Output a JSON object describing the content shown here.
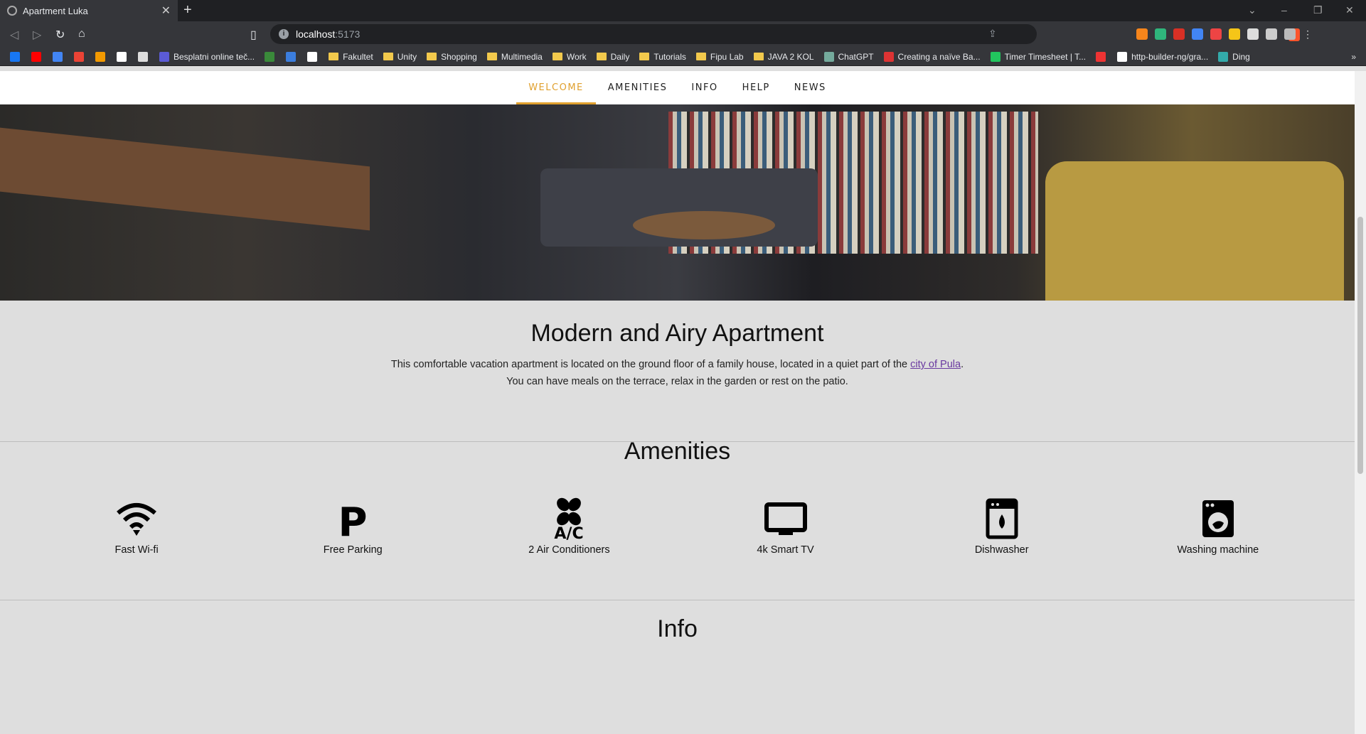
{
  "browser": {
    "tab_title": "Apartment Luka",
    "url_host": "localhost",
    "url_port": ":5173",
    "bookmarks": [
      {
        "label": "",
        "icon": "facebook-icon",
        "color": "#1877f2"
      },
      {
        "label": "",
        "icon": "youtube-icon",
        "color": "#ff0000"
      },
      {
        "label": "",
        "icon": "translate-icon",
        "color": "#4285f4"
      },
      {
        "label": "",
        "icon": "gmail-icon",
        "color": "#ea4335"
      },
      {
        "label": "",
        "icon": "in-icon",
        "color": "#f29900"
      },
      {
        "label": "",
        "icon": "github-icon",
        "color": "#ffffff"
      },
      {
        "label": "",
        "icon": "monitor-icon",
        "color": "#dddddd"
      },
      {
        "label": "Besplatni online teč...",
        "icon": "course-icon",
        "color": "#5b5bd6"
      },
      {
        "label": "",
        "icon": "leaf-icon",
        "color": "#3a8a3a"
      },
      {
        "label": "",
        "icon": "diamond-icon",
        "color": "#3b7ddd"
      },
      {
        "label": "",
        "icon": "notion-icon",
        "color": "#ffffff"
      },
      {
        "label": "Fakultet",
        "icon": "folder-icon"
      },
      {
        "label": "Unity",
        "icon": "folder-icon"
      },
      {
        "label": "Shopping",
        "icon": "folder-icon"
      },
      {
        "label": "Multimedia",
        "icon": "folder-icon"
      },
      {
        "label": "Work",
        "icon": "folder-icon"
      },
      {
        "label": "Daily",
        "icon": "folder-icon"
      },
      {
        "label": "Tutorials",
        "icon": "folder-icon"
      },
      {
        "label": "Fipu Lab",
        "icon": "folder-icon"
      },
      {
        "label": "JAVA 2 KOL",
        "icon": "folder-icon"
      },
      {
        "label": "ChatGPT",
        "icon": "chatgpt-icon",
        "color": "#74aa9c"
      },
      {
        "label": "Creating a naïve Ba...",
        "icon": "article-icon",
        "color": "#d33"
      },
      {
        "label": "Timer Timesheet | T...",
        "icon": "timer-icon",
        "color": "#22c55e"
      },
      {
        "label": "",
        "icon": "pin-icon",
        "color": "#e33"
      },
      {
        "label": "http-builder-ng/gra...",
        "icon": "github-icon",
        "color": "#ffffff"
      },
      {
        "label": "Ding",
        "icon": "ding-icon",
        "color": "#3aa"
      }
    ]
  },
  "nav": {
    "items": [
      "WELCOME",
      "AMENITIES",
      "INFO",
      "HELP",
      "NEWS"
    ],
    "active": "WELCOME",
    "accent": "#e0a02e"
  },
  "welcome": {
    "title": "Modern and Airy Apartment",
    "line1_pre": "This comfortable vacation apartment is located on the ground floor of a family house, located in a quiet part of the ",
    "link": "city of Pula",
    "line1_post": ".",
    "line2": "You can have meals on the terrace, relax in the garden or rest on the patio."
  },
  "amenities": {
    "title": "Amenities",
    "items": [
      {
        "label": "Fast Wi-fi",
        "icon": "wifi-icon"
      },
      {
        "label": "Free Parking",
        "icon": "parking-icon"
      },
      {
        "label": "2 Air Conditioners",
        "icon": "air-conditioner-icon"
      },
      {
        "label": "4k Smart TV",
        "icon": "tv-icon"
      },
      {
        "label": "Dishwasher",
        "icon": "dishwasher-icon"
      },
      {
        "label": "Washing machine",
        "icon": "washing-machine-icon"
      }
    ]
  },
  "info": {
    "title": "Info"
  }
}
